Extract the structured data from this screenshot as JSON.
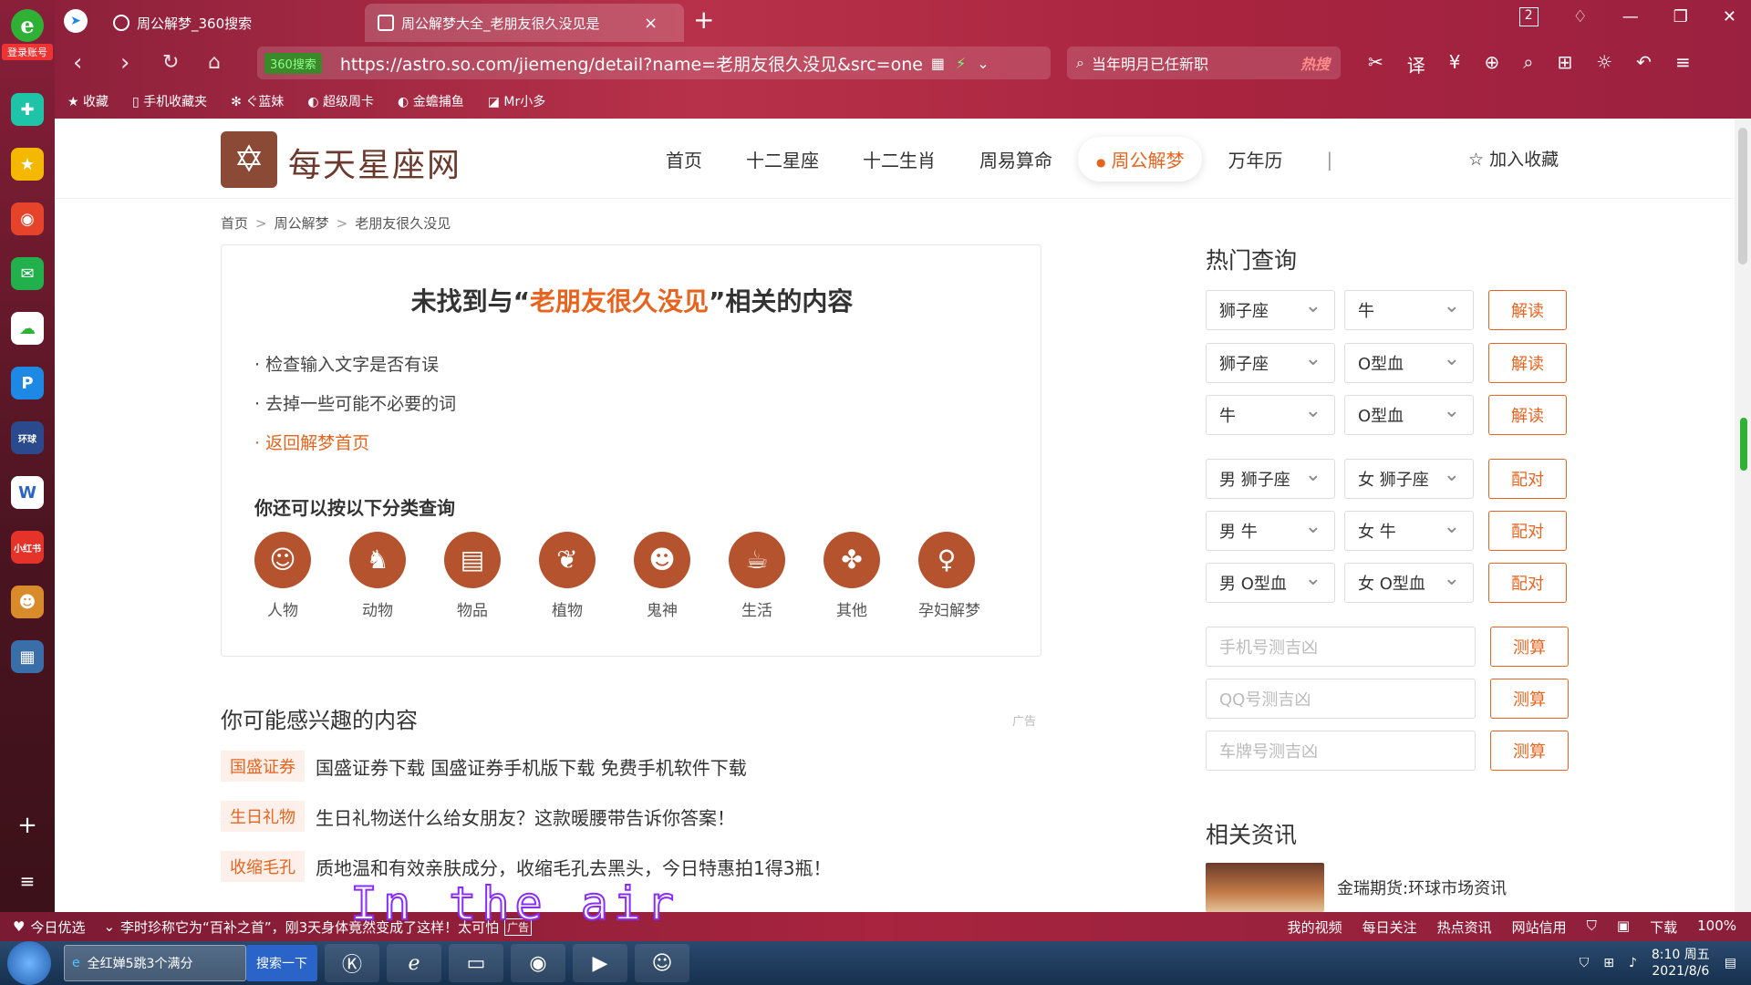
{
  "browser": {
    "brand_label": "登录账号",
    "tabs": [
      {
        "label": "周公解梦_360搜索"
      },
      {
        "label": "周公解梦大全_老朋友很久没见是"
      }
    ],
    "tab_count": "2",
    "address_badge": "360搜索",
    "url": "https://astro.so.com/jiemeng/detail?name=老朋友很久没见&src=onebox-bi",
    "search_text": "当年明月已任新职",
    "search_hot": "热搜",
    "bookmarks": [
      "收藏",
      "手机收藏夹",
      "ぐ蓝妹",
      "超级周卡",
      "金蟾捕鱼",
      "Mr小多"
    ]
  },
  "site": {
    "logo_text": "每天星座网",
    "nav": [
      "首页",
      "十二星座",
      "十二生肖",
      "周易算命",
      "周公解梦",
      "万年历"
    ],
    "nav_active": "周公解梦",
    "nav_divider": "|",
    "favorite": "加入收藏",
    "breadcrumb": [
      "首页",
      "周公解梦",
      "老朋友很久没见"
    ]
  },
  "not_found": {
    "prefix": "未找到与“",
    "keyword": "老朋友很久没见",
    "suffix": "”相关的内容",
    "tips": [
      "· 检查输入文字是否有误",
      "· 去掉一些可能不必要的词"
    ],
    "link": "· 返回解梦首页",
    "category_title": "你还可以按以下分类查询",
    "categories": [
      "人物",
      "动物",
      "物品",
      "植物",
      "鬼神",
      "生活",
      "其他",
      "孕妇解梦"
    ]
  },
  "interest": {
    "title": "你可能感兴趣的内容",
    "ad_label": "广告",
    "items": [
      {
        "tag": "国盛证券",
        "text": "国盛证券下载 国盛证券手机版下载 免费手机软件下载"
      },
      {
        "tag": "生日礼物",
        "text": "生日礼物送什么给女朋友？这款暖腰带告诉你答案！"
      },
      {
        "tag": "收缩毛孔",
        "text": "质地温和有效亲肤成分，收缩毛孔去黑头，今日特惠拍1得3瓶！"
      }
    ]
  },
  "sidebar": {
    "hot_title": "热门查询",
    "query_rows": [
      {
        "a": "狮子座",
        "b": "牛",
        "btn": "解读"
      },
      {
        "a": "狮子座",
        "b": "O型血",
        "btn": "解读"
      },
      {
        "a": "牛",
        "b": "O型血",
        "btn": "解读"
      },
      {
        "a": "男 狮子座",
        "b": "女 狮子座",
        "btn": "配对"
      },
      {
        "a": "男 牛",
        "b": "女 牛",
        "btn": "配对"
      },
      {
        "a": "男 O型血",
        "b": "女 O型血",
        "btn": "配对"
      }
    ],
    "input_rows": [
      {
        "placeholder": "手机号测吉凶",
        "btn": "测算"
      },
      {
        "placeholder": "QQ号测吉凶",
        "btn": "测算"
      },
      {
        "placeholder": "车牌号测吉凶",
        "btn": "测算"
      }
    ],
    "news_title": "相关资讯",
    "news_item": "金瑞期货:环球市场资讯"
  },
  "overlay_text": "In the air",
  "statusbar": {
    "left1": "今日优选",
    "left2": "李时珍称它为“百补之首”，刚3天身体竟然变成了这样！太可怕",
    "ad": "广告",
    "right": [
      "我的视频",
      "每日关注",
      "热点资讯",
      "网站信用",
      "下载",
      "100%"
    ]
  },
  "taskbar": {
    "task_text": "全红婵5跳3个满分",
    "search_btn": "搜索一下",
    "time": "8:10 周五",
    "date": "2021/8/6"
  }
}
